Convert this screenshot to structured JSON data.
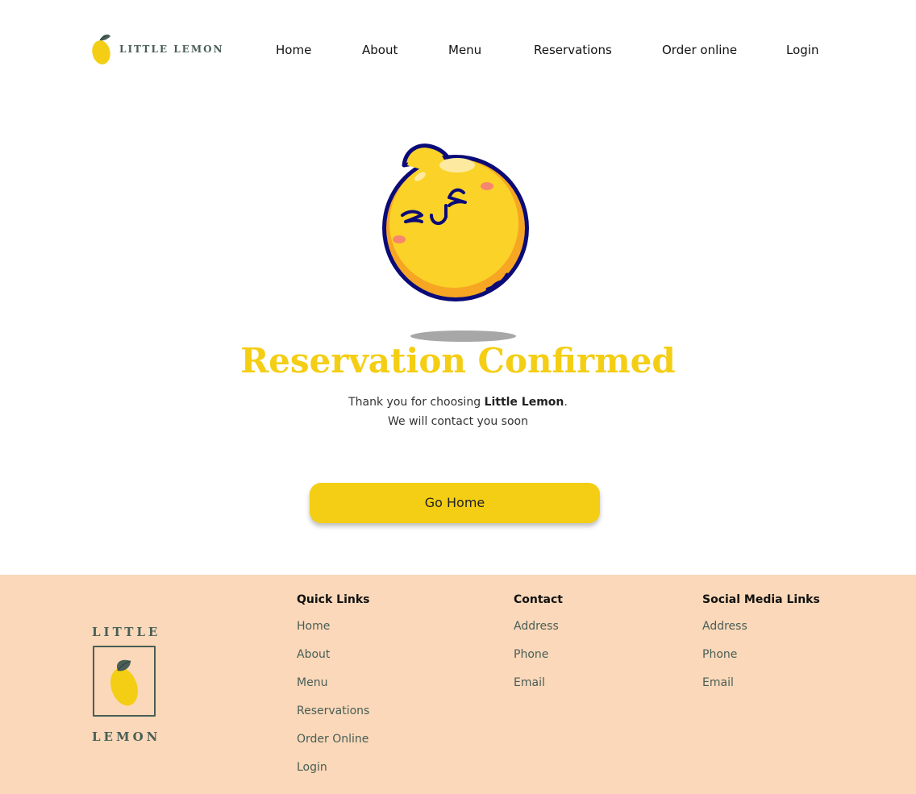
{
  "header": {
    "brand": "LITTLE LEMON",
    "nav": [
      {
        "label": "Home"
      },
      {
        "label": "About"
      },
      {
        "label": "Menu"
      },
      {
        "label": "Reservations"
      },
      {
        "label": "Order online"
      },
      {
        "label": "Login"
      }
    ]
  },
  "main": {
    "title": "Reservation Confirmed",
    "message_prefix": "Thank you for choosing ",
    "message_brand": "Little Lemon",
    "message_suffix": ".",
    "message_line2": "We will contact you soon",
    "button_label": "Go Home"
  },
  "footer": {
    "logo_top": "LITTLE",
    "logo_bottom": "LEMON",
    "columns": [
      {
        "heading": "Quick Links",
        "links": [
          "Home",
          "About",
          "Menu",
          "Reservations",
          "Order Online",
          "Login"
        ]
      },
      {
        "heading": "Contact",
        "links": [
          "Address",
          "Phone",
          "Email"
        ]
      },
      {
        "heading": "Social Media Links",
        "links": [
          "Address",
          "Phone",
          "Email"
        ]
      }
    ]
  },
  "colors": {
    "brand_yellow": "#f4ce14",
    "brand_green": "#495e57",
    "footer_bg": "#fad8b9"
  },
  "icons": {
    "header_logo": "lemon-icon",
    "mascot": "smiling-lemon-illustration",
    "footer_logo": "lemon-icon"
  }
}
